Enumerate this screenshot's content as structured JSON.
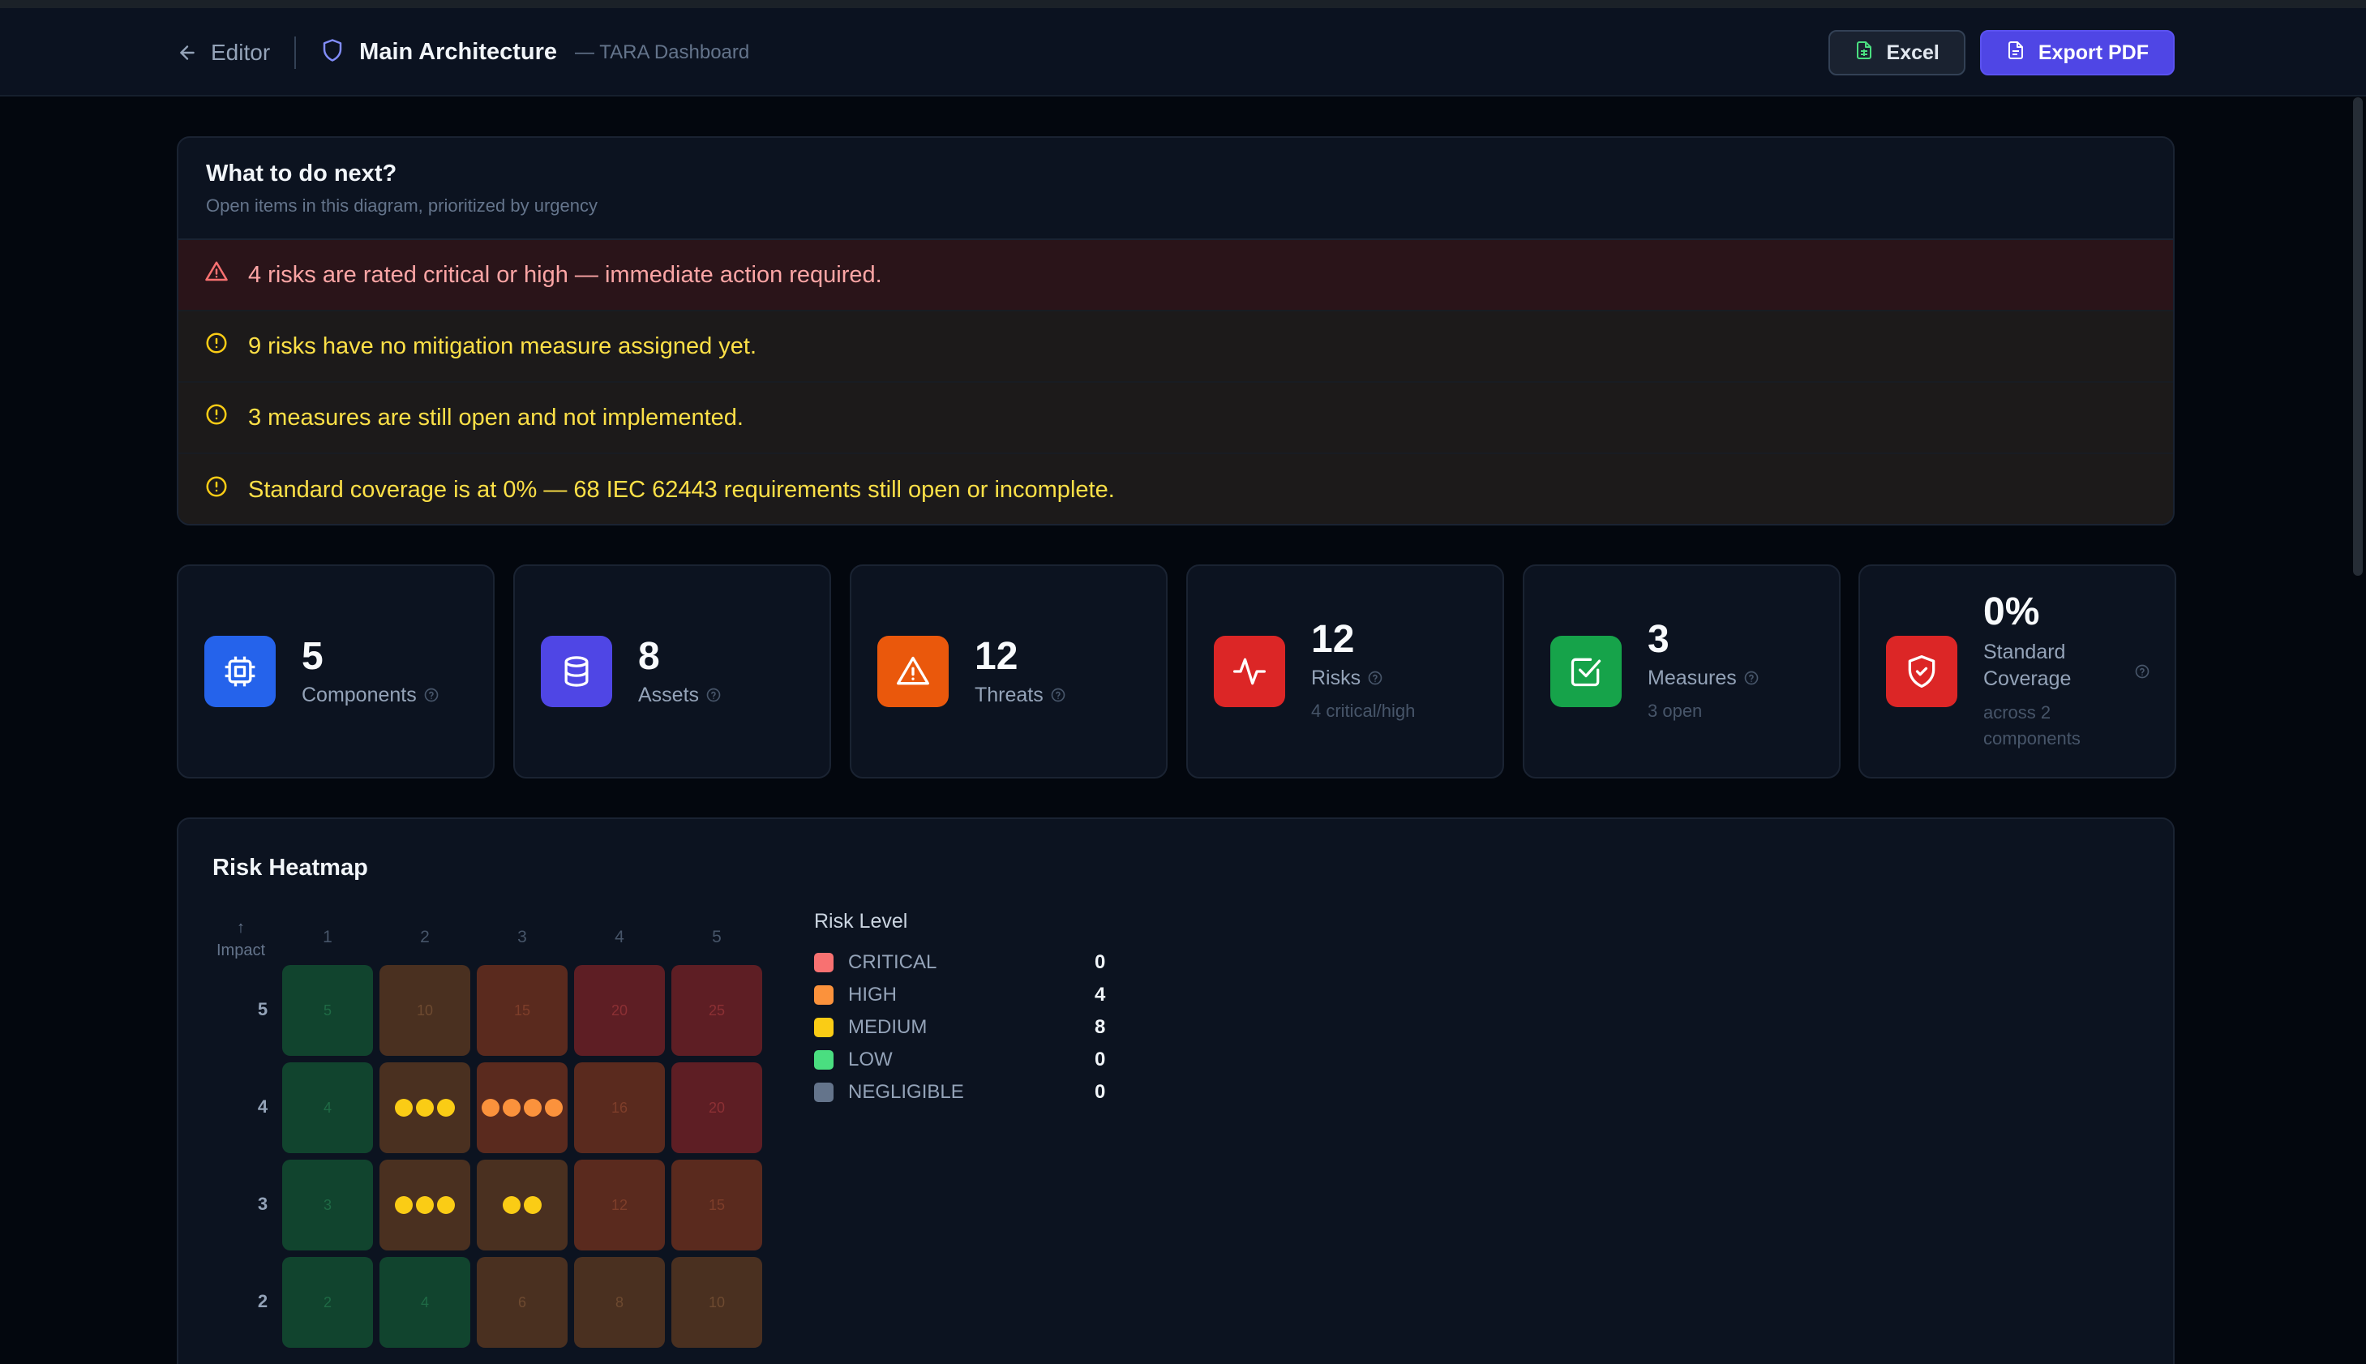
{
  "header": {
    "back_label": "Editor",
    "title": "Main Architecture",
    "subtitle": "— TARA Dashboard",
    "excel_label": "Excel",
    "pdf_label": "Export PDF"
  },
  "todo": {
    "title": "What to do next?",
    "subtitle": "Open items in this diagram, prioritized by urgency",
    "items": [
      {
        "severity": "critical",
        "icon": "alert-triangle-icon",
        "text": "4 risks are rated critical or high — immediate action required."
      },
      {
        "severity": "warning",
        "icon": "alert-circle-icon",
        "text": "9 risks have no mitigation measure assigned yet."
      },
      {
        "severity": "warning",
        "icon": "alert-circle-icon",
        "text": "3 measures are still open and not implemented."
      },
      {
        "severity": "warning",
        "icon": "alert-circle-icon",
        "text": "Standard coverage is at 0% — 68 IEC 62443 requirements still open or incomplete."
      }
    ]
  },
  "stats": [
    {
      "value": "5",
      "label": "Components",
      "sub": "",
      "icon": "cpu-icon",
      "color": "#2563eb"
    },
    {
      "value": "8",
      "label": "Assets",
      "sub": "",
      "icon": "database-icon",
      "color": "#4f46e5"
    },
    {
      "value": "12",
      "label": "Threats",
      "sub": "",
      "icon": "warning-triangle-icon",
      "color": "#ea580c"
    },
    {
      "value": "12",
      "label": "Risks",
      "sub": "4 critical/high",
      "icon": "activity-icon",
      "color": "#dc2626"
    },
    {
      "value": "3",
      "label": "Measures",
      "sub": "3 open",
      "icon": "check-square-icon",
      "color": "#16a34a"
    },
    {
      "value": "0%",
      "label": "Standard Coverage",
      "sub": "across 2 components",
      "icon": "shield-check-icon",
      "color": "#dc2626"
    }
  ],
  "heatmap": {
    "title": "Risk Heatmap",
    "axis_label": "Impact",
    "axis_arrow": "↑",
    "columns": [
      "1",
      "2",
      "3",
      "4",
      "5"
    ],
    "rows": [
      {
        "label": "5",
        "cells": [
          {
            "score": "5",
            "level": "g",
            "dots": 0,
            "dot_color": ""
          },
          {
            "score": "10",
            "level": "o",
            "dots": 0,
            "dot_color": ""
          },
          {
            "score": "15",
            "level": "r",
            "dots": 0,
            "dot_color": ""
          },
          {
            "score": "20",
            "level": "rr",
            "dots": 0,
            "dot_color": ""
          },
          {
            "score": "25",
            "level": "rr",
            "dots": 0,
            "dot_color": ""
          }
        ]
      },
      {
        "label": "4",
        "cells": [
          {
            "score": "4",
            "level": "g",
            "dots": 0,
            "dot_color": ""
          },
          {
            "score": "",
            "level": "o",
            "dots": 3,
            "dot_color": "y"
          },
          {
            "score": "",
            "level": "r",
            "dots": 4,
            "dot_color": "or"
          },
          {
            "score": "16",
            "level": "r",
            "dots": 0,
            "dot_color": ""
          },
          {
            "score": "20",
            "level": "rr",
            "dots": 0,
            "dot_color": ""
          }
        ]
      },
      {
        "label": "3",
        "cells": [
          {
            "score": "3",
            "level": "g",
            "dots": 0,
            "dot_color": ""
          },
          {
            "score": "",
            "level": "o",
            "dots": 3,
            "dot_color": "y"
          },
          {
            "score": "",
            "level": "o",
            "dots": 2,
            "dot_color": "y"
          },
          {
            "score": "12",
            "level": "r",
            "dots": 0,
            "dot_color": ""
          },
          {
            "score": "15",
            "level": "r",
            "dots": 0,
            "dot_color": ""
          }
        ]
      },
      {
        "label": "2",
        "cells": [
          {
            "score": "2",
            "level": "g",
            "dots": 0,
            "dot_color": ""
          },
          {
            "score": "4",
            "level": "g",
            "dots": 0,
            "dot_color": ""
          },
          {
            "score": "6",
            "level": "o",
            "dots": 0,
            "dot_color": ""
          },
          {
            "score": "8",
            "level": "o",
            "dots": 0,
            "dot_color": ""
          },
          {
            "score": "10",
            "level": "o",
            "dots": 0,
            "dot_color": ""
          }
        ]
      }
    ],
    "legend": {
      "title": "Risk Level",
      "items": [
        {
          "label": "CRITICAL",
          "count": "0",
          "color": "#f87171"
        },
        {
          "label": "HIGH",
          "count": "4",
          "color": "#fb923c"
        },
        {
          "label": "MEDIUM",
          "count": "8",
          "color": "#facc15"
        },
        {
          "label": "LOW",
          "count": "0",
          "color": "#4ade80"
        },
        {
          "label": "NEGLIGIBLE",
          "count": "0",
          "color": "#64748b"
        }
      ]
    }
  }
}
